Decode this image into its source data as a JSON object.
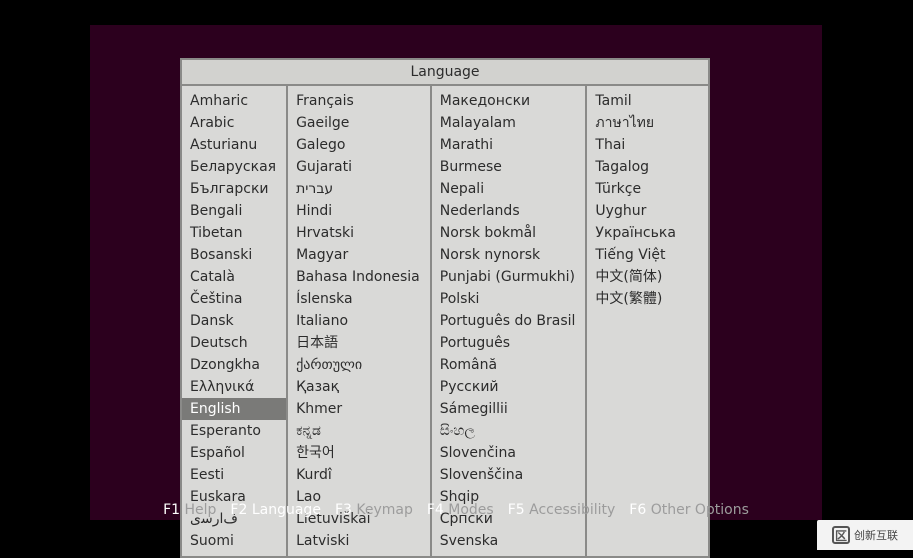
{
  "panel": {
    "title": "Language",
    "selected": "English",
    "columns": [
      [
        "Amharic",
        "Arabic",
        "Asturianu",
        "Беларуская",
        "Български",
        "Bengali",
        "Tibetan",
        "Bosanski",
        "Català",
        "Čeština",
        "Dansk",
        "Deutsch",
        "Dzongkha",
        "Ελληνικά",
        "English",
        "Esperanto",
        "Español",
        "Eesti",
        "Euskara",
        "ﻑﺍﺭﺳی",
        "Suomi"
      ],
      [
        "Français",
        "Gaeilge",
        "Galego",
        "Gujarati",
        "עברית",
        "Hindi",
        "Hrvatski",
        "Magyar",
        "Bahasa Indonesia",
        "Íslenska",
        "Italiano",
        "日本語",
        "ქართული",
        "Қазақ",
        "Khmer",
        "ಕನ್ನಡ",
        "한국어",
        "Kurdî",
        "Lao",
        "Lietuviškai",
        "Latviski"
      ],
      [
        "Македонски",
        "Malayalam",
        "Marathi",
        "Burmese",
        "Nepali",
        "Nederlands",
        "Norsk bokmål",
        "Norsk nynorsk",
        "Punjabi (Gurmukhi)",
        "Polski",
        "Português do Brasil",
        "Português",
        "Română",
        "Русский",
        "Sámegillii",
        "සිංහල",
        "Slovenčina",
        "Slovenščina",
        "Shqip",
        "Српски",
        "Svenska"
      ],
      [
        "Tamil",
        "ภาษาไทย",
        "Thai",
        "Tagalog",
        "Türkçe",
        "Uyghur",
        "Українська",
        "Tiếng Việt",
        "中文(简体)",
        "中文(繁體)"
      ]
    ]
  },
  "footer": [
    {
      "key": "F1",
      "label": "Help"
    },
    {
      "key": "F2",
      "label": "Language"
    },
    {
      "key": "F3",
      "label": "Keymap"
    },
    {
      "key": "F4",
      "label": "Modes"
    },
    {
      "key": "F5",
      "label": "Accessibility"
    },
    {
      "key": "F6",
      "label": "Other Options"
    }
  ],
  "watermark": {
    "logo": "区",
    "text": "创新互联"
  },
  "active_footer": "F2"
}
